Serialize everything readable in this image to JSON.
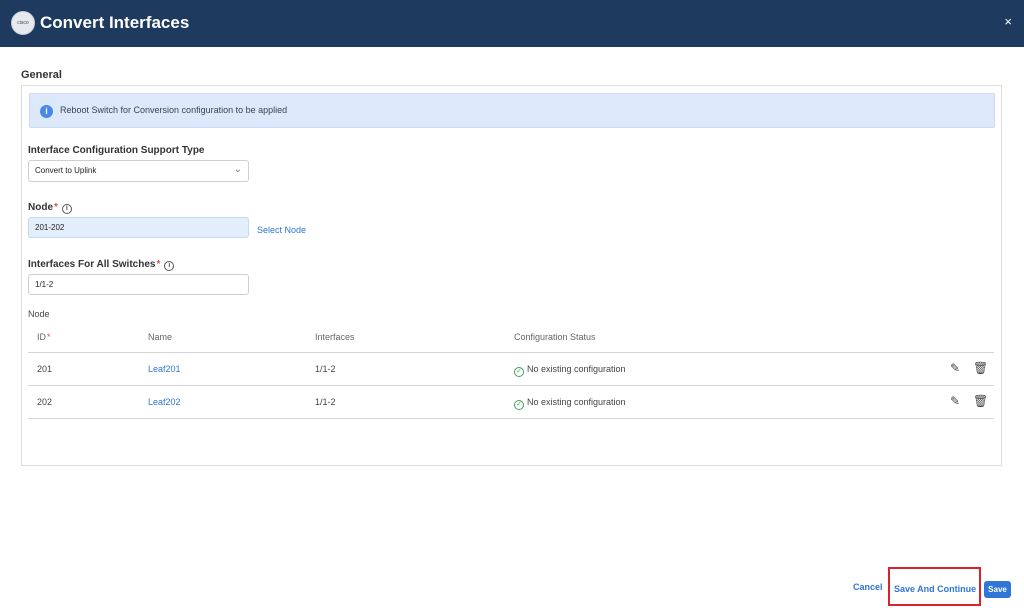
{
  "dialog": {
    "title": "Convert Interfaces",
    "logo_text": "cisco",
    "close_glyph": "×"
  },
  "section": {
    "title": "General"
  },
  "alert": {
    "text": "Reboot Switch for Conversion configuration to be applied",
    "icon": "info-icon"
  },
  "fields": {
    "support_type": {
      "label": "Interface Configuration Support Type",
      "value": "Convert to Uplink"
    },
    "node": {
      "label": "Node",
      "value": "201-202",
      "action": "Select Node"
    },
    "interfaces": {
      "label": "Interfaces For All Switches",
      "value": "1/1-2"
    }
  },
  "table": {
    "label": "Node",
    "headers": {
      "id": "ID",
      "name": "Name",
      "interfaces": "Interfaces",
      "status": "Configuration Status"
    },
    "rows": [
      {
        "id": "201",
        "name": "Leaf201",
        "interfaces": "1/1-2",
        "status": "No existing configuration"
      },
      {
        "id": "202",
        "name": "Leaf202",
        "interfaces": "1/1-2",
        "status": "No existing configuration"
      }
    ]
  },
  "footer": {
    "cancel": "Cancel",
    "save_and_continue": "Save And Continue",
    "save": "Save"
  },
  "colors": {
    "header_bg": "#1f3a5f",
    "accent": "#2f76d6",
    "highlight": "#d6232c",
    "success": "#3aa55a"
  }
}
